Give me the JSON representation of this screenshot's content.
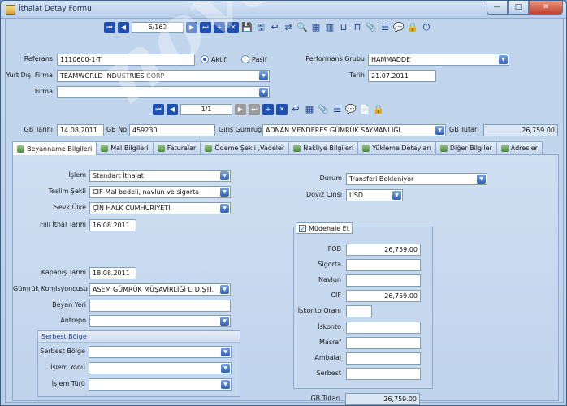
{
  "window": {
    "title": "İthalat Detay Formu",
    "min": "—",
    "max": "□",
    "close": "✕"
  },
  "topnav": {
    "position": "6/162"
  },
  "header": {
    "referans_label": "Referans",
    "referans": "1110600-1-T",
    "aktif": "Aktif",
    "pasif": "Pasif",
    "yurtdisi_label": "Yurt Dışı Firma",
    "yurtdisi": "TEAMWORLD INDUSTRIES CORP",
    "firma_label": "Firma",
    "firma": "",
    "perf_label": "Performans Grubu",
    "perf": "HAMMADDE",
    "tarih_label": "Tarih",
    "tarih": "21.07.2011"
  },
  "subnav": {
    "position": "1/1"
  },
  "gb": {
    "tarih_label": "GB Tarihi",
    "tarih": "14.08.2011",
    "no_label": "GB No",
    "no": "459230",
    "giris_label": "Giriş Gümrüğü",
    "giris": "ADNAN MENDERES GÜMRÜK SAYMANLIĞI",
    "tutar_label": "GB Tutarı",
    "tutar": "26,759.00"
  },
  "tabs": [
    "Beyanname Bilgileri",
    "Mal Bilgileri",
    "Faturalar",
    "Ödeme Şekli ,Vadeler",
    "Nakliye Bilgileri",
    "Yükleme Detayları",
    "Diğer Bilgiler",
    "Adresler"
  ],
  "form": {
    "islem_label": "İşlem",
    "islem": "Standart İthalat",
    "teslim_label": "Teslim Şekli",
    "teslim": "CIF-Mal bedeli, navlun ve sigorta",
    "sevk_label": "Sevk Ülke",
    "sevk": "ÇİN HALK CUMHURİYETİ",
    "fiili_label": "Fiili İthal Tarihi",
    "fiili": "16.08.2011",
    "kapanis_label": "Kapanış Tarihi",
    "kapanis": "18.08.2011",
    "komisyon_label": "Gümrük Komisyoncusu",
    "komisyon": "ASEM GÜMRÜK MÜŞAVİRLİĞİ LTD.ŞTİ.",
    "beyan_label": "Beyan Yeri",
    "beyan": "",
    "antrepo_label": "Antrepo",
    "antrepo": "",
    "durum_label": "Durum",
    "durum": "Transferi Bekleniyor",
    "doviz_label": "Döviz Cinsi",
    "doviz": "USD"
  },
  "serbest": {
    "title": "Serbest Bölge",
    "bolge_label": "Serbest Bölge",
    "yon_label": "İşlem Yönü",
    "tur_label": "İşlem Türü"
  },
  "costs": {
    "mudehale": "Müdehale Et",
    "fob_label": "FOB",
    "fob": "26,759.00",
    "sigorta_label": "Sigorta",
    "sigorta": "",
    "navlun_label": "Navlun",
    "navlun": "",
    "cif_label": "CIF",
    "cif": "26,759.00",
    "iskonto_orani_label": "İskonto Oranı",
    "iskonto_orani": "",
    "iskonto_label": "İskonto",
    "iskonto": "",
    "masraf_label": "Masraf",
    "masraf": "",
    "ambalaj_label": "Ambalaj",
    "ambalaj": "",
    "serbest_label": "Serbest",
    "serbest": "",
    "gbtutar_label": "GB Tutarı",
    "gbtutar": "26,759.00"
  },
  "watermark": "novafortis"
}
